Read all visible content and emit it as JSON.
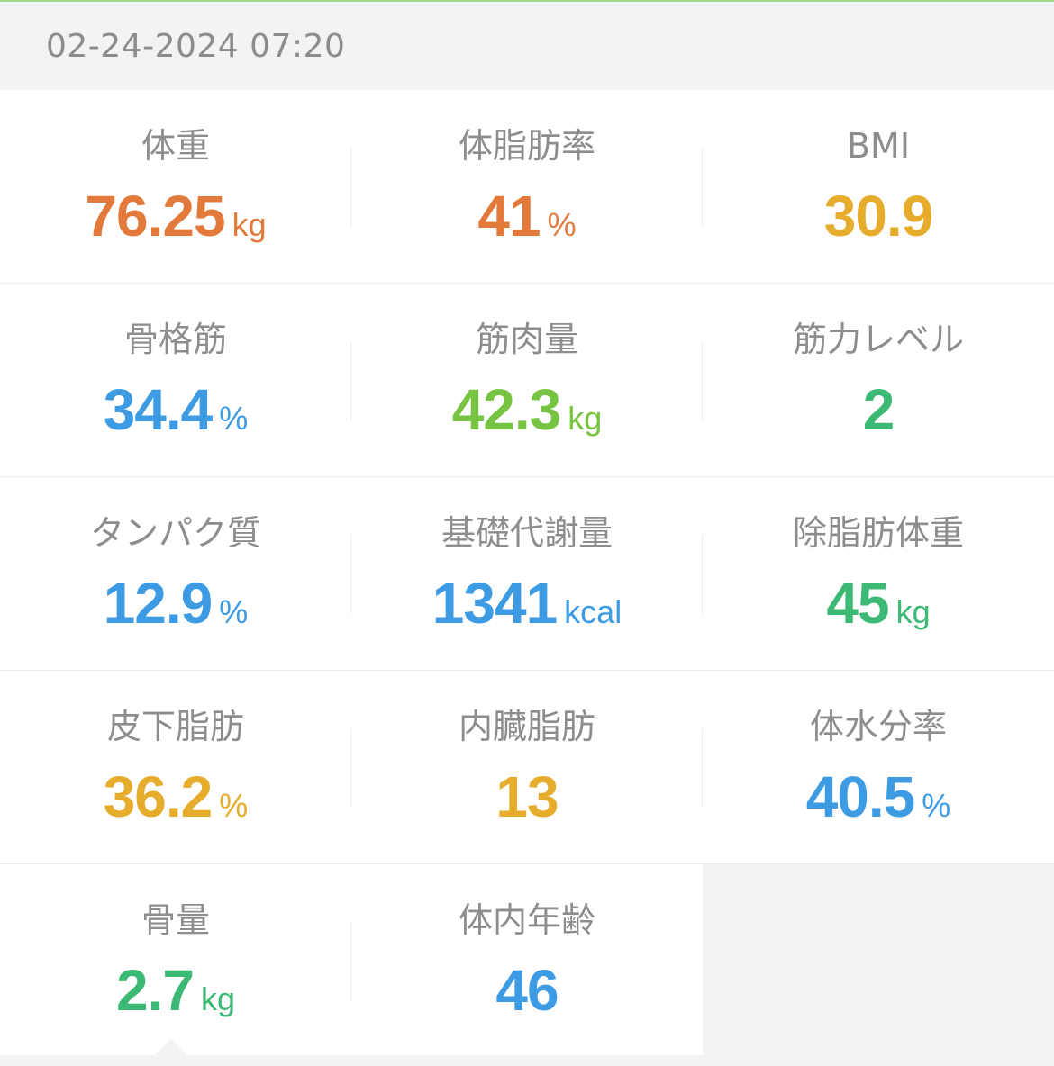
{
  "header": {
    "date": "02-24-2024 07:20"
  },
  "metrics": [
    {
      "label": "体重",
      "value": "76.25",
      "unit": "kg",
      "color": "#e27a3c"
    },
    {
      "label": "体脂肪率",
      "value": "41",
      "unit": "%",
      "color": "#e27a3c"
    },
    {
      "label": "BMI",
      "value": "30.9",
      "unit": "",
      "color": "#e6ad2c"
    },
    {
      "label": "骨格筋",
      "value": "34.4",
      "unit": "%",
      "color": "#3d9be4"
    },
    {
      "label": "筋肉量",
      "value": "42.3",
      "unit": "kg",
      "color": "#76c442"
    },
    {
      "label": "筋力レベル",
      "value": "2",
      "unit": "",
      "color": "#3db976"
    },
    {
      "label": "タンパク質",
      "value": "12.9",
      "unit": "%",
      "color": "#3d9be4"
    },
    {
      "label": "基礎代謝量",
      "value": "1341",
      "unit": "kcal",
      "color": "#3d9be4"
    },
    {
      "label": "除脂肪体重",
      "value": "45",
      "unit": "kg",
      "color": "#3db976"
    },
    {
      "label": "皮下脂肪",
      "value": "36.2",
      "unit": "%",
      "color": "#e6ad2c"
    },
    {
      "label": "内臓脂肪",
      "value": "13",
      "unit": "",
      "color": "#e6ad2c"
    },
    {
      "label": "体水分率",
      "value": "40.5",
      "unit": "%",
      "color": "#3d9be4"
    },
    {
      "label": "骨量",
      "value": "2.7",
      "unit": "kg",
      "color": "#3db976"
    },
    {
      "label": "体内年齢",
      "value": "46",
      "unit": "",
      "color": "#3d9be4"
    }
  ]
}
